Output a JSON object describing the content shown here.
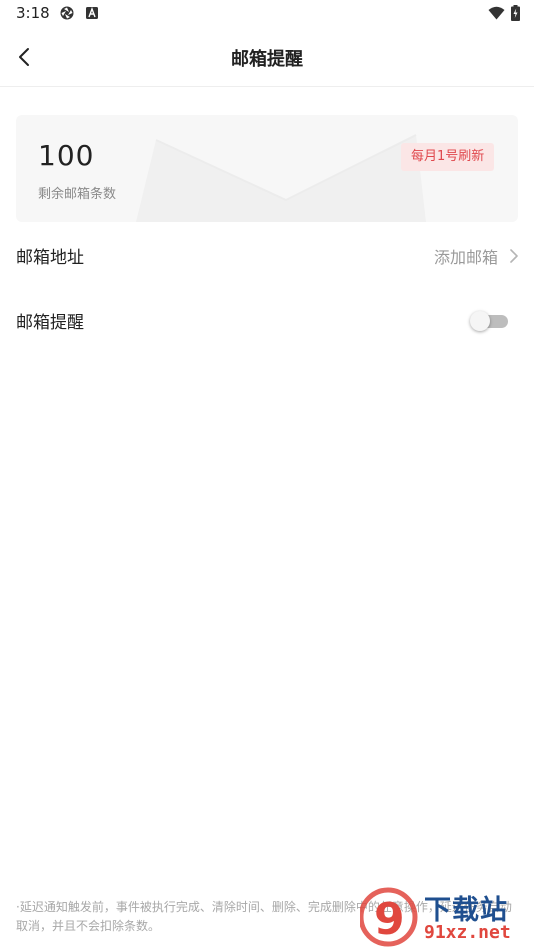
{
  "status_bar": {
    "time": "3:18",
    "icons": [
      "aperture-icon",
      "font-a-icon",
      "wifi-icon",
      "battery-charging-icon"
    ]
  },
  "nav": {
    "title": "邮箱提醒",
    "back_icon": "chevron-left-icon"
  },
  "quota_card": {
    "count": "100",
    "label": "剩余邮箱条数",
    "badge": "每月1号刷新",
    "badge_color": "#e0474c"
  },
  "email_address_row": {
    "label": "邮箱地址",
    "value": "添加邮箱"
  },
  "email_reminder_row": {
    "label": "邮箱提醒",
    "toggle_on": false
  },
  "footer": {
    "note": "·延迟通知触发前，事件被执行完成、清除时间、删除、完成删除中的任意操作，延迟任务自动取消，并且不会扣除条数。"
  },
  "watermark": {
    "top": "下载站",
    "bottom": "91xz.net",
    "mark": "9"
  }
}
